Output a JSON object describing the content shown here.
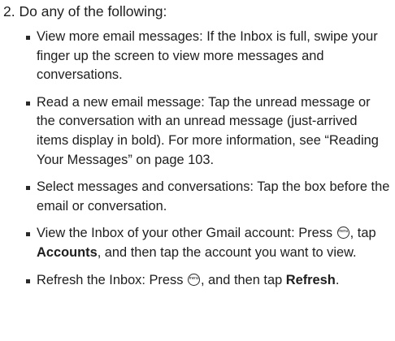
{
  "step": {
    "number": "2.",
    "text": "Do any of the following:"
  },
  "icons": {
    "menu_key": "menu-key-icon",
    "menu_key_label": "menu"
  },
  "items": [
    {
      "text": "View more email messages: If the Inbox is full, swipe your finger up the screen to view more messages and conversations."
    },
    {
      "text": "Read a new email message: Tap the unread message or the conversation with an unread message (just-arrived items display in bold). For more information, see “Reading Your Messages” on page 103."
    },
    {
      "text": "Select messages and conversations: Tap the box before the email or conversation."
    },
    {
      "part1": "View the Inbox of your other Gmail account: Press ",
      "part2": ", tap ",
      "bold": "Accounts",
      "part3": ", and then tap the account you want to view."
    },
    {
      "part1": "Refresh the Inbox: Press ",
      "part2": ", and then tap ",
      "bold": "Refresh",
      "part3": "."
    }
  ]
}
